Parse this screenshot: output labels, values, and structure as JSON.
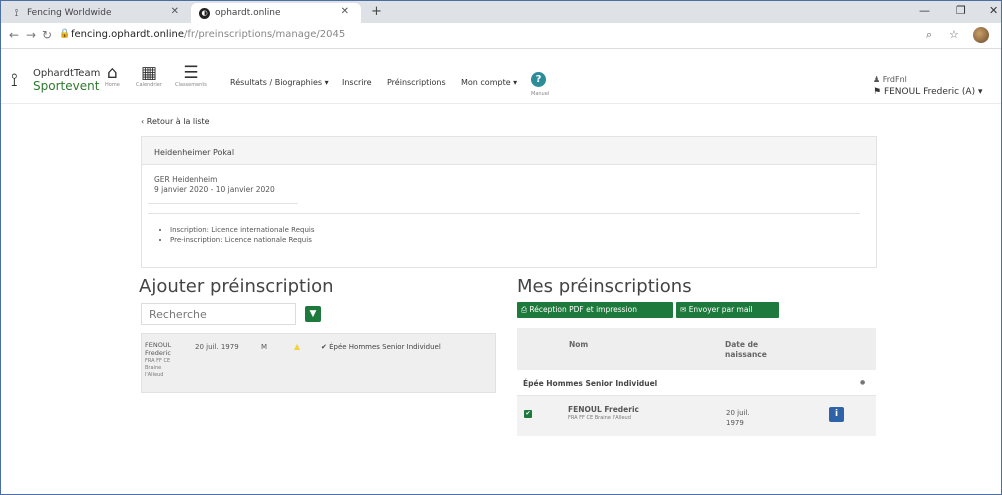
{
  "browser": {
    "tabs": [
      {
        "label": "Fencing Worldwide",
        "active": false
      },
      {
        "label": "ophardt.online",
        "active": true
      }
    ],
    "url_host": "fencing.ophardt.online",
    "url_path": "/fr/preinscriptions/manage/2045"
  },
  "site": {
    "logo_line1": "OphardtTeam",
    "logo_line2": "Sportevent",
    "icon_home_label": "Home",
    "icon_calendar_label": "Calendrier",
    "icon_rank_label": "Classements",
    "nav": {
      "results": "Résultats / Biographies",
      "register": "Inscrire",
      "preregistrations": "Préinscriptions",
      "account": "Mon compte"
    },
    "help_label": "Manuel",
    "user_login": "FrdFnl",
    "user_name": "FENOUL Frederic (A)"
  },
  "back_link": "Retour à la liste",
  "event": {
    "name": "Heidenheimer Pokal",
    "location": "GER Heidenheim",
    "dates": "9 janvier 2020 - 10 janvier 2020",
    "requirements": [
      "Inscription: Licence internationale Requis",
      "Pre-inscription: Licence nationale Requis"
    ]
  },
  "add": {
    "title": "Ajouter préinscription",
    "search_placeholder": "Recherche",
    "result": {
      "name_line1": "FENOUL",
      "name_line2": "Frederic",
      "club_line1": "FRA FF CE",
      "club_line2": "Braine",
      "club_line3": "l'Alleud",
      "birthdate": "20 juil. 1979",
      "sex": "M",
      "event": "Épée Hommes Senior Individuel"
    }
  },
  "mine": {
    "title": "Mes préinscriptions",
    "pdf_button": "Réception PDF et impression",
    "mail_button": "Envoyer par mail",
    "col_name": "Nom",
    "col_birth_line1": "Date de",
    "col_birth_line2": "naissance",
    "group": "Épée Hommes Senior Individuel",
    "rows": [
      {
        "name": "FENOUL Frederic",
        "club": "FRA FF CE Braine l'Alleud",
        "birth_line1": "20 juil.",
        "birth_line2": "1979"
      }
    ]
  }
}
